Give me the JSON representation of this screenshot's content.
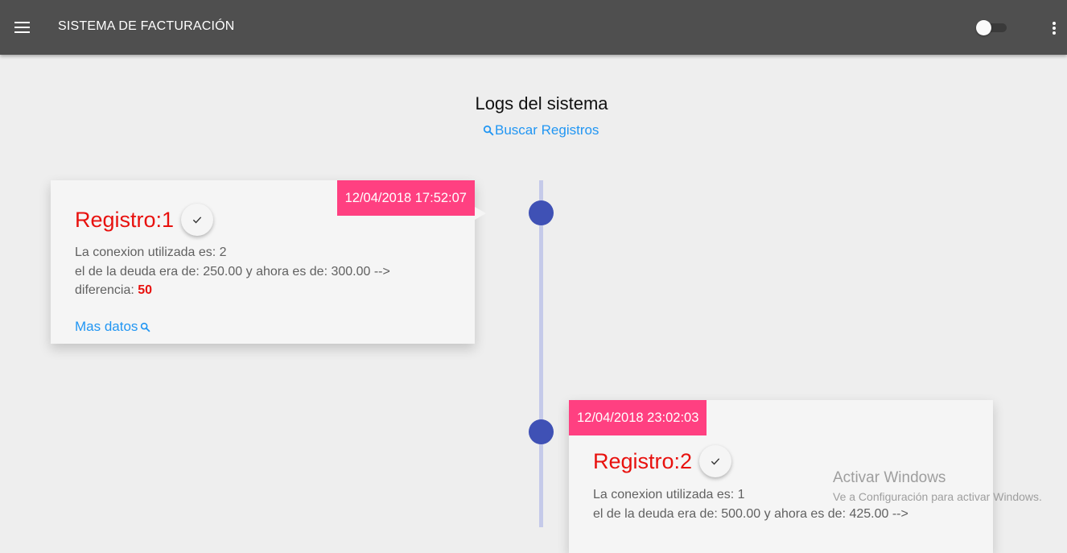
{
  "appbar": {
    "title": "SISTEMA DE FACTURACIÓN",
    "menu_icon": "menu-icon",
    "more_icon": "more-vert-icon",
    "toggle_on": false,
    "background": "#4f4f4f"
  },
  "page": {
    "title": "Logs del sistema",
    "search_label": "Buscar Registros",
    "search_icon": "search-icon"
  },
  "colors": {
    "accent_pink": "#ff4081",
    "timeline_dot": "#3f51b5",
    "timeline_line": "#c5cae9",
    "registro_red": "#e8110e",
    "link_blue": "#2196f3"
  },
  "logs": [
    {
      "date": "12/04/2018 17:52:07",
      "title": "Registro:1",
      "line1": "La conexion utilizada es: 2",
      "line2": "el de la deuda era de: 250.00 y ahora es de: 300.00 -->",
      "diff_label": "diferencia:",
      "diff_value": "50",
      "more_label": "Mas datos"
    },
    {
      "date": "12/04/2018 23:02:03",
      "title": "Registro:2",
      "line1": "La conexion utilizada es: 1",
      "line2": "el de la deuda era de: 500.00 y ahora es de: 425.00 -->"
    }
  ],
  "watermark": {
    "title": "Activar Windows",
    "subtitle": "Ve a Configuración para activar Windows."
  }
}
